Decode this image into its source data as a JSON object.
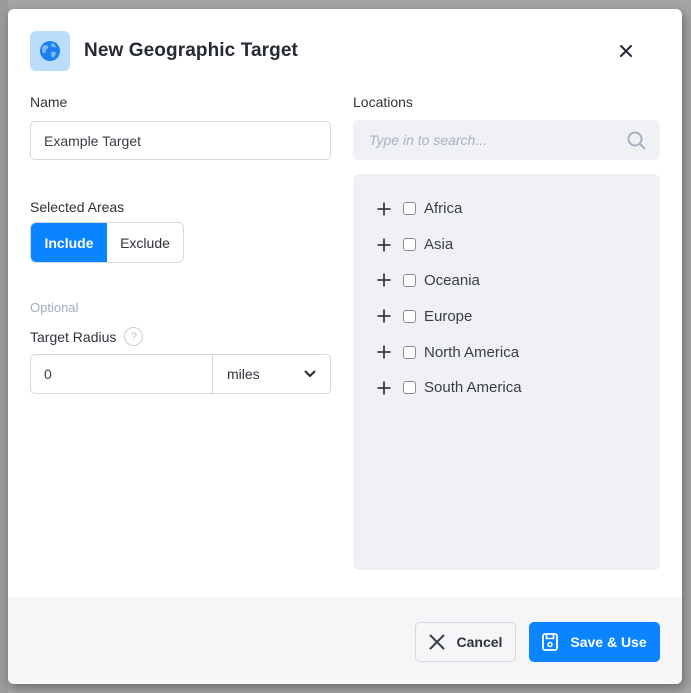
{
  "dialog": {
    "title": "New Geographic Target",
    "icon": "globe-icon",
    "close_icon": "close-icon"
  },
  "form": {
    "name_label": "Name",
    "name_value": "Example Target",
    "selected_areas_label": "Selected Areas",
    "include_label": "Include",
    "exclude_label": "Exclude",
    "selected_mode": "Include",
    "optional_label": "Optional",
    "radius_label": "Target Radius",
    "help_glyph": "?",
    "radius_value": "0",
    "unit_value": "miles"
  },
  "locations": {
    "label": "Locations",
    "search_placeholder": "Type in to search...",
    "items": [
      {
        "label": "Africa",
        "checked": false
      },
      {
        "label": "Asia",
        "checked": false
      },
      {
        "label": "Oceania",
        "checked": false
      },
      {
        "label": "Europe",
        "checked": false
      },
      {
        "label": "North America",
        "checked": false
      },
      {
        "label": "South America",
        "checked": false
      }
    ]
  },
  "footer": {
    "cancel_label": "Cancel",
    "save_label": "Save & Use"
  },
  "colors": {
    "accent": "#0b84ff",
    "icon_bg": "#bcdcfc",
    "panel_bg": "#eff1f5"
  }
}
